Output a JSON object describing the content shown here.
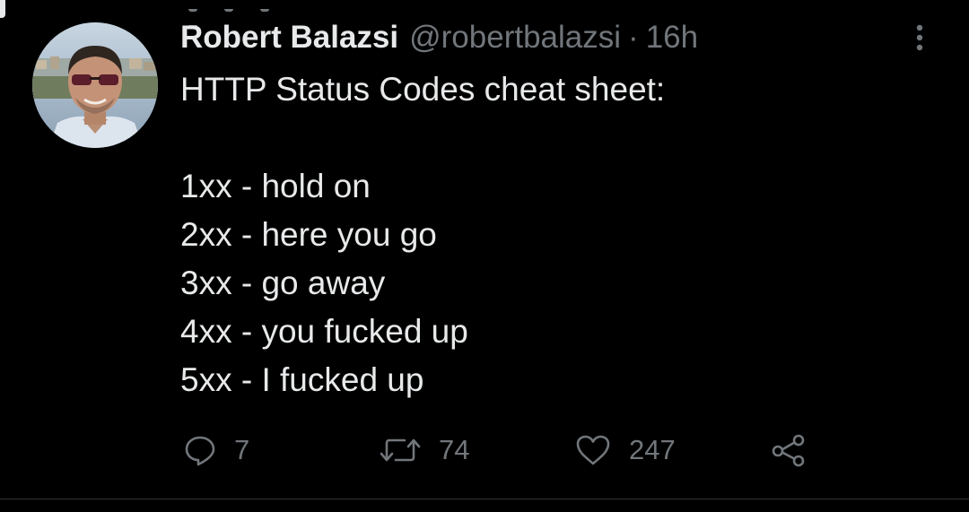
{
  "tweet": {
    "author": {
      "display_name": "Robert Balazsi",
      "handle": "@robertbalazsi",
      "avatar_icon": "avatar-photo"
    },
    "separator": "·",
    "time": "16h",
    "text_lines": [
      "HTTP Status Codes cheat sheet:",
      "",
      "1xx - hold on",
      "2xx - here you go",
      "3xx - go away",
      "4xx - you fucked up",
      "5xx - I fucked up"
    ],
    "actions": {
      "reply": {
        "icon": "reply-icon",
        "count": "7"
      },
      "retweet": {
        "icon": "retweet-icon",
        "count": "74"
      },
      "like": {
        "icon": "heart-icon",
        "count": "247"
      },
      "share": {
        "icon": "share-icon"
      }
    },
    "more_icon": "more-vertical-icon"
  },
  "colors": {
    "background": "#000000",
    "primary_text": "#e7e9ea",
    "secondary_text": "#71767b",
    "divider": "#2f3336"
  }
}
